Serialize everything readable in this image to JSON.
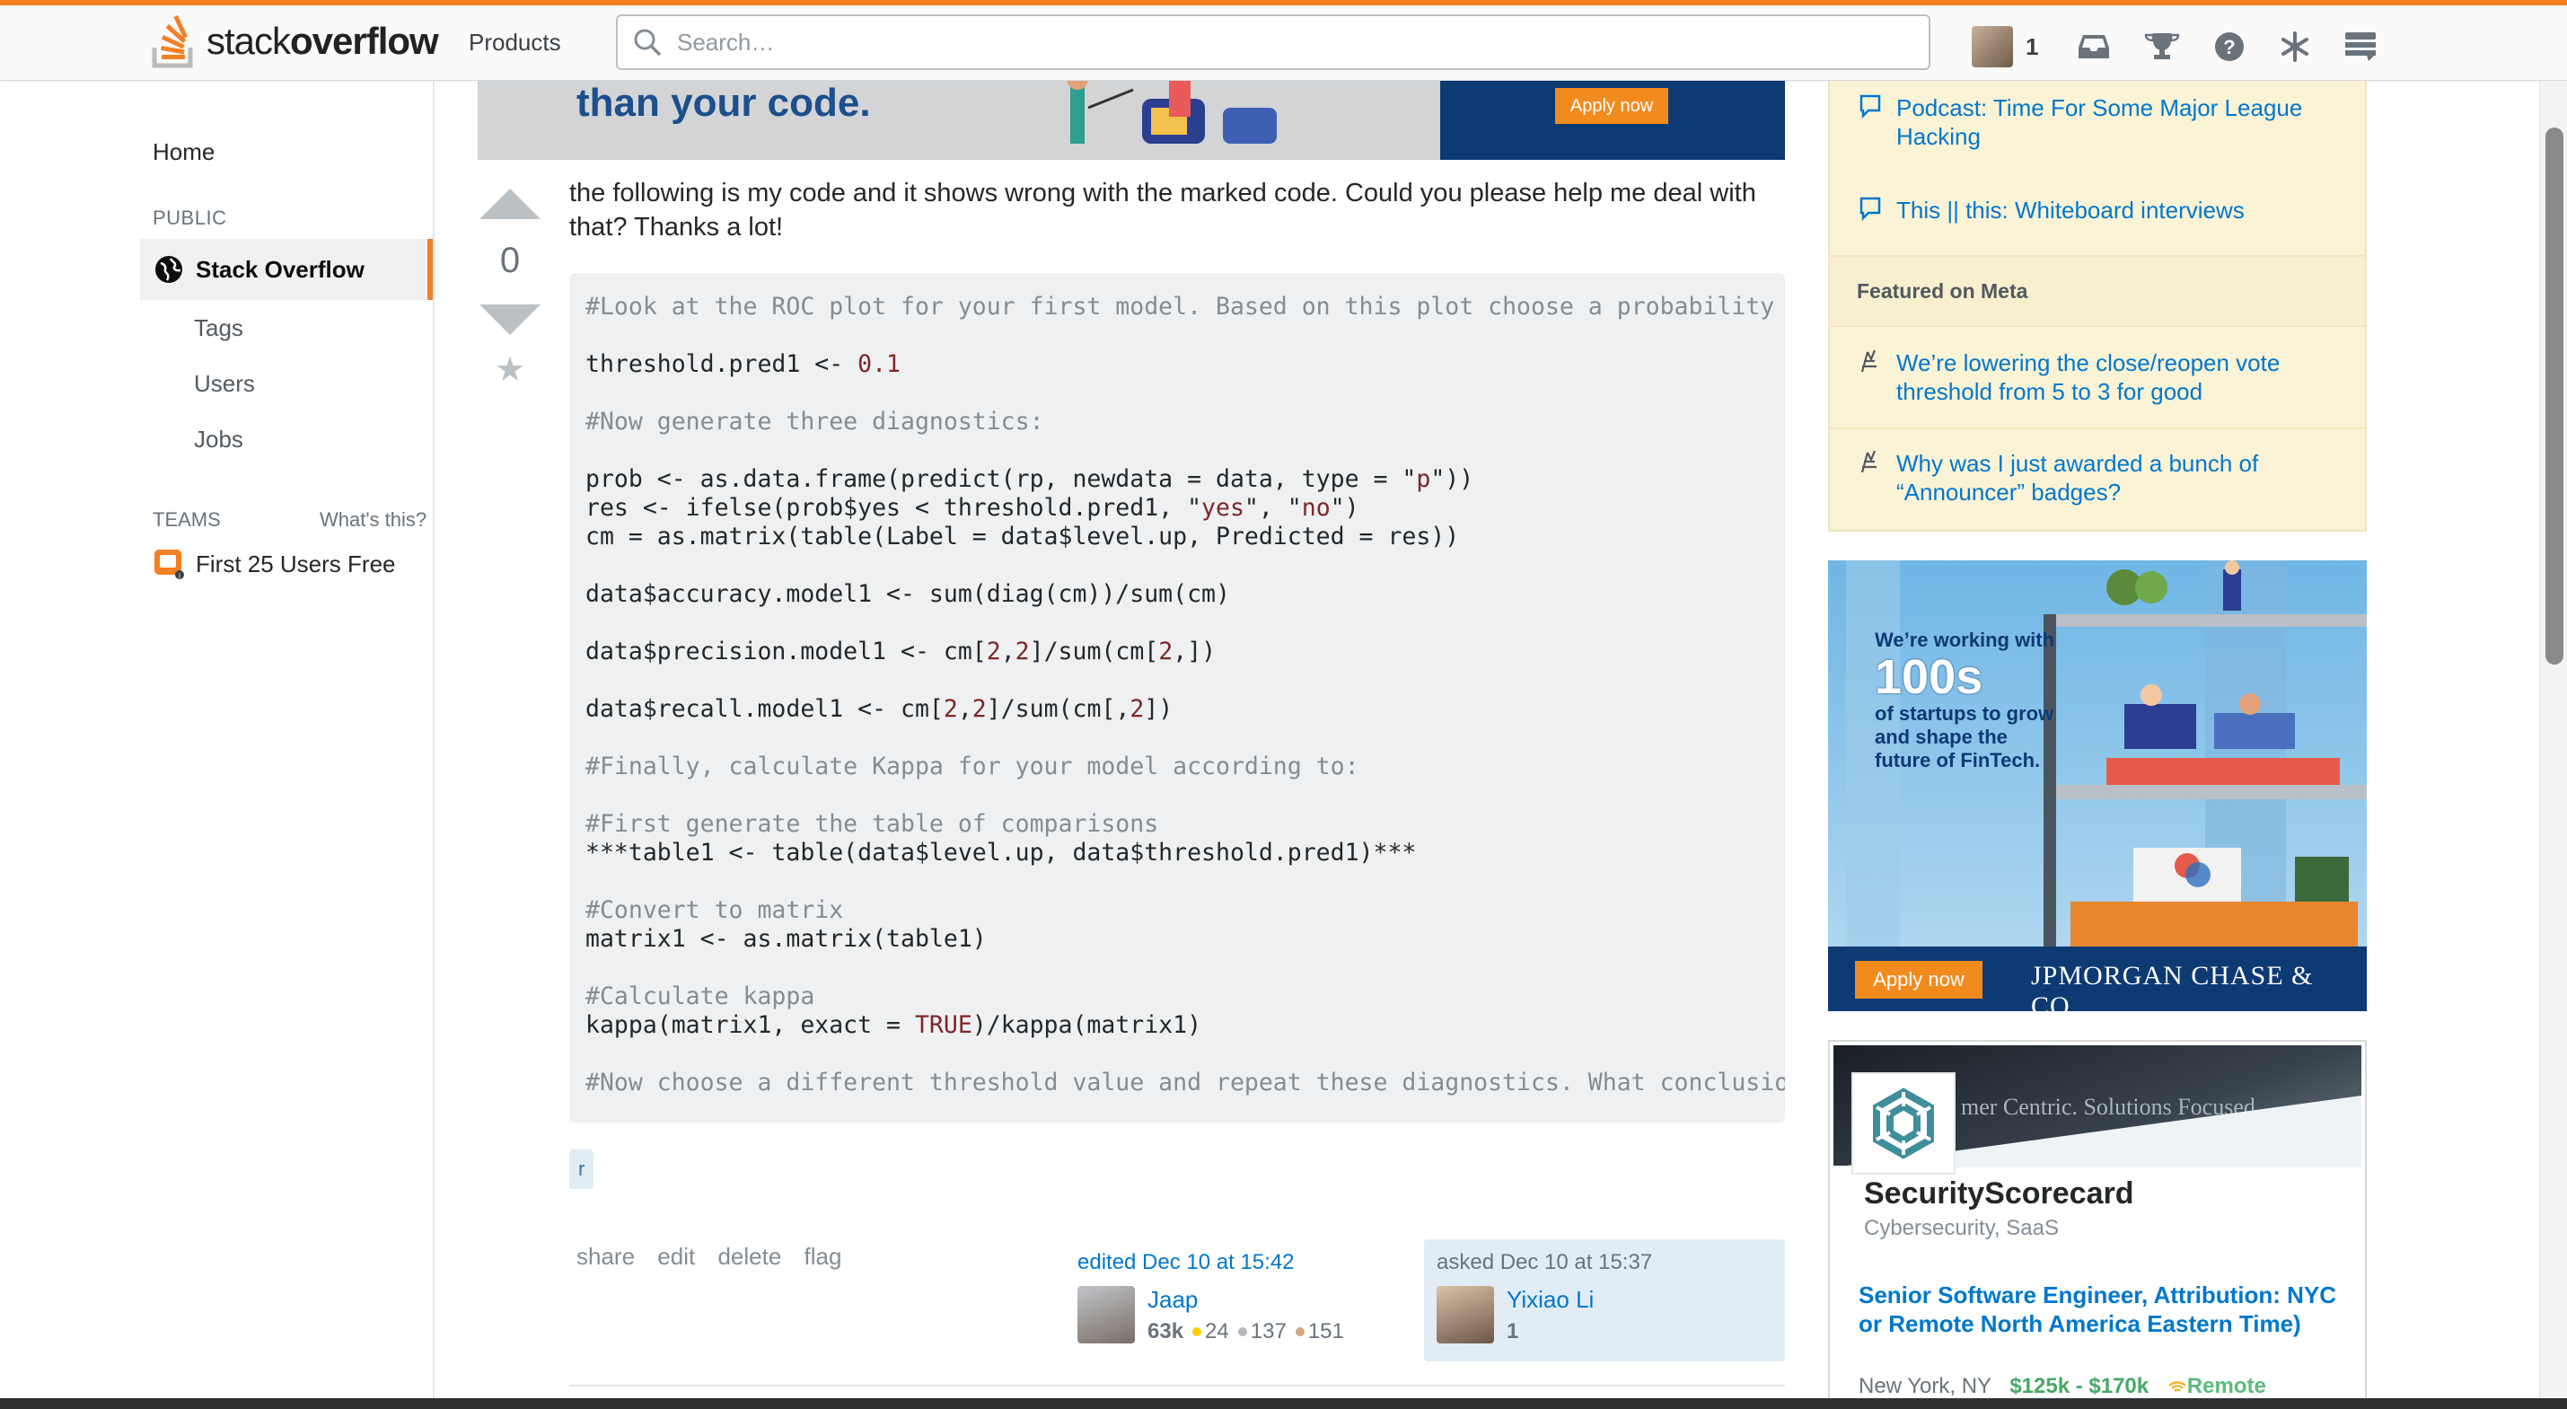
{
  "header": {
    "logo_stack": "stack",
    "logo_overflow": "overflow",
    "products": "Products",
    "search_placeholder": "Search…",
    "reputation": "1",
    "icons": [
      "avatar",
      "inbox-icon",
      "achievements-icon",
      "help-icon",
      "review-icon",
      "site-switcher-icon"
    ]
  },
  "sidebar": {
    "home": "Home",
    "public": "PUBLIC",
    "stackoverflow": "Stack Overflow",
    "items": [
      "Tags",
      "Users",
      "Jobs"
    ],
    "teams": "TEAMS",
    "whats_this": "What's this?",
    "team_link": "First 25 Users Free"
  },
  "banner": {
    "text": "than your code.",
    "button": "Apply now"
  },
  "question": {
    "votes": "0",
    "intro": "the following is my code and it shows wrong with the marked code. Could you please help me deal with that? Thanks a lot!",
    "code_lines": [
      "#Look at the ROC plot for your first model. Based on this plot choose a probability threshold",
      "",
      "threshold.pred1 <- 0.1",
      "",
      "#Now generate three diagnostics:",
      "",
      "prob <- as.data.frame(predict(rp, newdata = data, type = \"p\"))",
      "res <- ifelse(prob$yes < threshold.pred1, \"yes\", \"no\")",
      "cm = as.matrix(table(Label = data$level.up, Predicted = res))",
      "",
      "data$accuracy.model1 <- sum(diag(cm))/sum(cm)",
      "",
      "data$precision.model1 <- cm[2,2]/sum(cm[2,])",
      "",
      "data$recall.model1 <- cm[2,2]/sum(cm[,2])",
      "",
      "#Finally, calculate Kappa for your model according to:",
      "",
      "#First generate the table of comparisons",
      "***table1 <- table(data$level.up, data$threshold.pred1)***",
      "",
      "#Convert to matrix",
      "matrix1 <- as.matrix(table1)",
      "",
      "#Calculate kappa",
      "kappa(matrix1, exact = TRUE)/kappa(matrix1)",
      "",
      "#Now choose a different threshold value and repeat these diagnostics. What conclusions can you draw"
    ],
    "tag": "r",
    "menu": [
      "share",
      "edit",
      "delete",
      "flag"
    ],
    "edited": {
      "label": "edited Dec 10 at 15:42",
      "user": "Jaap",
      "rep": "63k",
      "gold": "24",
      "silver": "137",
      "bronze": "151"
    },
    "asked": {
      "label": "asked Dec 10 at 15:37",
      "user": "Yixiao Li",
      "rep": "1"
    }
  },
  "right": {
    "blog_items": [
      "Podcast: Time For Some Major League Hacking",
      "This || this: Whiteboard interviews"
    ],
    "meta_head": "Featured on Meta",
    "meta_items": [
      "We’re lowering the close/reopen vote threshold from 5 to 3 for good",
      "Why was I just awarded a bunch of “Announcer” badges?"
    ],
    "ad": {
      "line1": "We’re working with",
      "big": "100s",
      "line2": "of startups to grow",
      "line3": "and shape the",
      "line4": "future of FinTech.",
      "button": "Apply now",
      "brand": "JPMORGAN CHASE & CO."
    },
    "job": {
      "hero_text": "mer Centric. Solutions Focused",
      "company": "SecurityScorecard",
      "sector": "Cybersecurity, SaaS",
      "title": "Senior Software Engineer, Attribution: NYC or Remote North America Eastern Time)",
      "location": "New York, NY",
      "salary": "$125k - $170k",
      "remote": "Remote"
    }
  },
  "colors": {
    "accent": "#f48024",
    "link": "#0077cc",
    "code_bg": "#eff0f1",
    "yellow_panel": "#fbf3d5"
  }
}
